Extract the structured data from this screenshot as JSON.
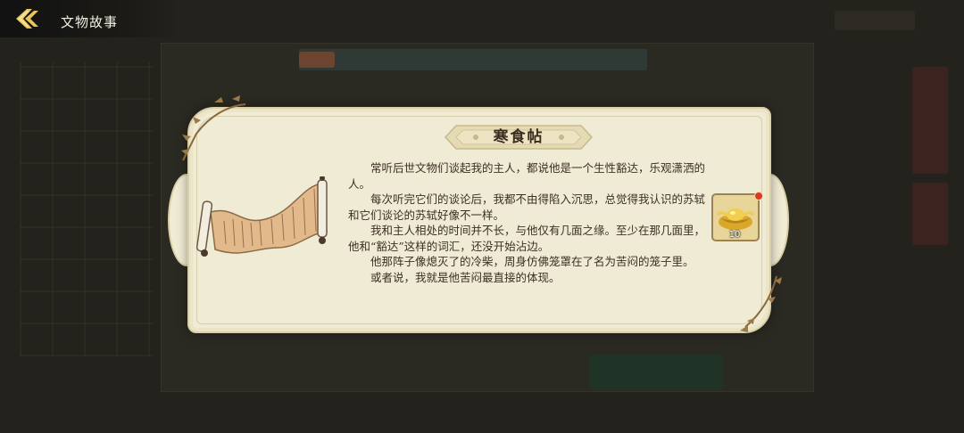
{
  "header": {
    "back_icon": "back-chevron-icon",
    "title": "文物故事"
  },
  "artifact": {
    "name": "寒食帖",
    "image_icon": "scroll-icon",
    "story": [
      "常听后世文物们谈起我的主人，都说他是一个生性豁达，乐观潇洒的人。",
      "每次听完它们的谈论后，我都不由得陷入沉思，总觉得我认识的苏轼和它们谈论的苏轼好像不一样。",
      "我和主人相处的时间并不长，与他仅有几面之缘。至少在那几面里，他和“豁达”这样的词汇，还没开始沾边。",
      "他那阵子像熄灭了的冷柴，周身仿佛笼罩在了名为苦闷的笼子里。",
      "或者说，我就是他苦闷最直接的体现。"
    ]
  },
  "reward": {
    "icon": "gold-ingot-icon",
    "count": "10",
    "has_notification": true
  },
  "colors": {
    "card_bg": "#f0ebd4",
    "card_border": "#d9cfa6",
    "text": "#3b3022",
    "page_bg": "#23221c"
  }
}
